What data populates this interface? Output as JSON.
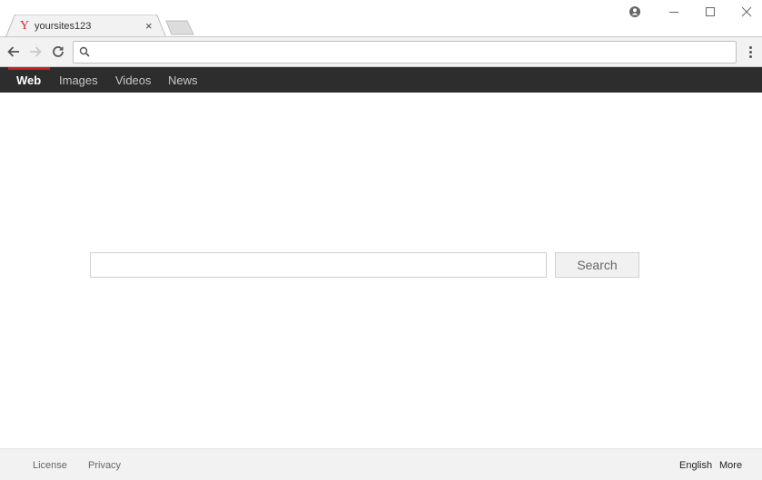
{
  "browser": {
    "tab": {
      "favicon": "Y",
      "title": "yoursites123",
      "close": "×"
    },
    "address_bar": {
      "value": "",
      "placeholder": ""
    },
    "icons": {
      "back": "arrow-left-icon",
      "forward": "arrow-right-icon",
      "reload": "reload-icon",
      "search": "search-icon",
      "menu": "kebab-menu-icon",
      "profile": "profile-icon",
      "minimize": "minimize-icon",
      "maximize": "maximize-icon",
      "close": "close-icon"
    }
  },
  "nav": {
    "items": [
      {
        "label": "Web",
        "active": true
      },
      {
        "label": "Images",
        "active": false
      },
      {
        "label": "Videos",
        "active": false
      },
      {
        "label": "News",
        "active": false
      }
    ],
    "accent_color": "#c91f1f"
  },
  "search": {
    "query": "",
    "placeholder": "",
    "button_label": "Search"
  },
  "footer": {
    "left_links": [
      "License",
      "Privacy"
    ],
    "right_links": [
      "English",
      "More"
    ]
  }
}
